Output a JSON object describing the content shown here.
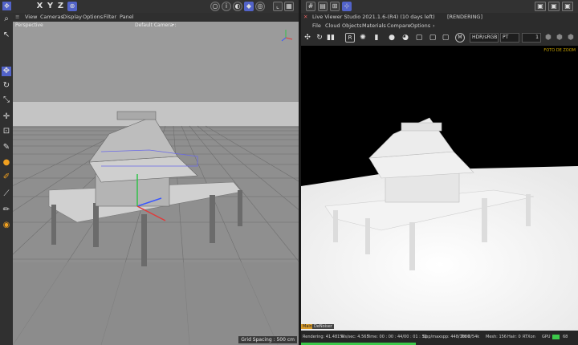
{
  "top_toolbar": {
    "axes": [
      "X",
      "Y",
      "Z"
    ],
    "render_icons": [
      "render-view-icon",
      "render-region-icon",
      "render-settings-icon"
    ]
  },
  "viewport": {
    "menu": [
      "View",
      "Cameras",
      "Display",
      "Options",
      "Filter",
      "Panel"
    ],
    "view_name": "Perspective",
    "camera": "Default Camera",
    "camera_suffix": "•:",
    "grid_spacing": "Grid Spacing : 500 cm"
  },
  "live_viewer": {
    "title": "Live Viewer Studio 2021.1.6-(R4) (10 days left)",
    "state": "[RENDERING]",
    "menu": [
      "File",
      "Cloud",
      "Objects",
      "Materials",
      "Compare",
      "Options"
    ],
    "color_space": "HDR/sRGB",
    "kernel": "PT",
    "value": "1",
    "overlay_text": "FOTO DE ZOOM",
    "toolbar_letters": {
      "r": "R",
      "m": "M"
    }
  },
  "status": {
    "rendering": "Rendering: 41.481%",
    "ms_sec": "Ms/sec: 4.565",
    "time": "Time: 00 : 00 : 44/00 : 01 : 53",
    "spp": "Spp/maxspp: 448/1080",
    "tri": "Tri: 0/54k",
    "mesh": "Mesh: 156",
    "hair": "Hair: 0",
    "rtx": "RTXon",
    "gpu": "GPU",
    "gpu_value": "68",
    "tabs": [
      "Main",
      "DeNoiser"
    ],
    "progress": 0.41481,
    "progress_color": "#3cc94a"
  }
}
